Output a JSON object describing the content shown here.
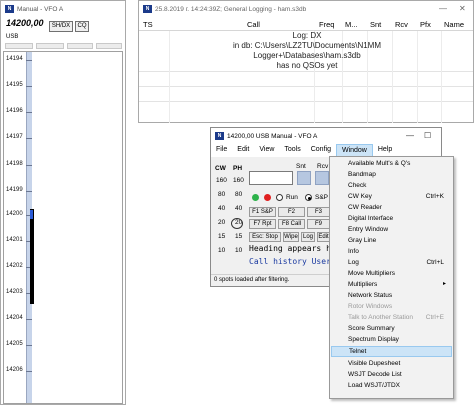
{
  "bandmap": {
    "title": "Manual - VFO A",
    "frequency": "14200,00",
    "shdx_button": "SH/DX",
    "cq_button": "CQ",
    "mode": "USB",
    "ticks": [
      "14194",
      "14195",
      "14196",
      "14197",
      "14198",
      "14199",
      "14200",
      "14201",
      "14202",
      "14203",
      "14204",
      "14205",
      "14206"
    ]
  },
  "log": {
    "title": "25.8.2019 г. 14:24:39Z; General Logging - ham.s3db",
    "columns": [
      "TS",
      "Call",
      "Freq",
      "M...",
      "Snt",
      "Rcv",
      "Pfx",
      "Name"
    ],
    "message": [
      "Log: DX",
      "in db: C:\\Users\\LZ2TU\\Documents\\N1MM Logger+\\Databases\\ham.s3db",
      "has no QSOs yet"
    ]
  },
  "entry": {
    "title": "14200,00 USB Manual - VFO A",
    "menu": [
      "File",
      "Edit",
      "View",
      "Tools",
      "Config",
      "Window",
      "Help"
    ],
    "labels": {
      "cw": "CW",
      "ph": "PH",
      "snt": "Snt",
      "rcv": "Rcv"
    },
    "bands": [
      "160",
      "80",
      "40",
      "20",
      "15",
      "10"
    ],
    "modes": {
      "run": "Run",
      "sp": "S&P"
    },
    "fkeys": [
      "F1 S&P",
      "F2",
      "F3",
      "F7 Rpt",
      "F8 Call",
      "F9",
      "Esc: Stop",
      "Wipe",
      "Log",
      "Edit"
    ],
    "hint_line1": "Heading appears h",
    "hint_line2": "Call history User",
    "status": "0 spots loaded after filtering."
  },
  "window_menu": {
    "items": [
      {
        "label": "Available Mult's & Q's",
        "shortcut": "",
        "state": "normal"
      },
      {
        "label": "Bandmap",
        "shortcut": "",
        "state": "normal"
      },
      {
        "label": "Check",
        "shortcut": "",
        "state": "normal"
      },
      {
        "label": "CW Key",
        "shortcut": "Ctrl+K",
        "state": "normal"
      },
      {
        "label": "CW Reader",
        "shortcut": "",
        "state": "normal"
      },
      {
        "label": "Digital Interface",
        "shortcut": "",
        "state": "normal"
      },
      {
        "label": "Entry Window",
        "shortcut": "",
        "state": "normal"
      },
      {
        "label": "Gray Line",
        "shortcut": "",
        "state": "normal"
      },
      {
        "label": "Info",
        "shortcut": "",
        "state": "normal"
      },
      {
        "label": "Log",
        "shortcut": "Ctrl+L",
        "state": "normal"
      },
      {
        "label": "Move Multipliers",
        "shortcut": "",
        "state": "normal"
      },
      {
        "label": "Multipliers",
        "shortcut": "▸",
        "state": "normal"
      },
      {
        "label": "Network Status",
        "shortcut": "",
        "state": "normal"
      },
      {
        "label": "Rotor Windows",
        "shortcut": "",
        "state": "disabled"
      },
      {
        "label": "Talk to Another Station",
        "shortcut": "Ctrl+E",
        "state": "disabled"
      },
      {
        "label": "Score Summary",
        "shortcut": "",
        "state": "normal"
      },
      {
        "label": "Spectrum Display",
        "shortcut": "",
        "state": "normal"
      },
      {
        "label": "Telnet",
        "shortcut": "",
        "state": "highlighted"
      },
      {
        "label": "Visible Dupesheet",
        "shortcut": "",
        "state": "normal"
      },
      {
        "label": "WSJT Decode List",
        "shortcut": "",
        "state": "normal"
      },
      {
        "label": "Load WSJT/JTDX",
        "shortcut": "",
        "state": "normal"
      }
    ]
  }
}
